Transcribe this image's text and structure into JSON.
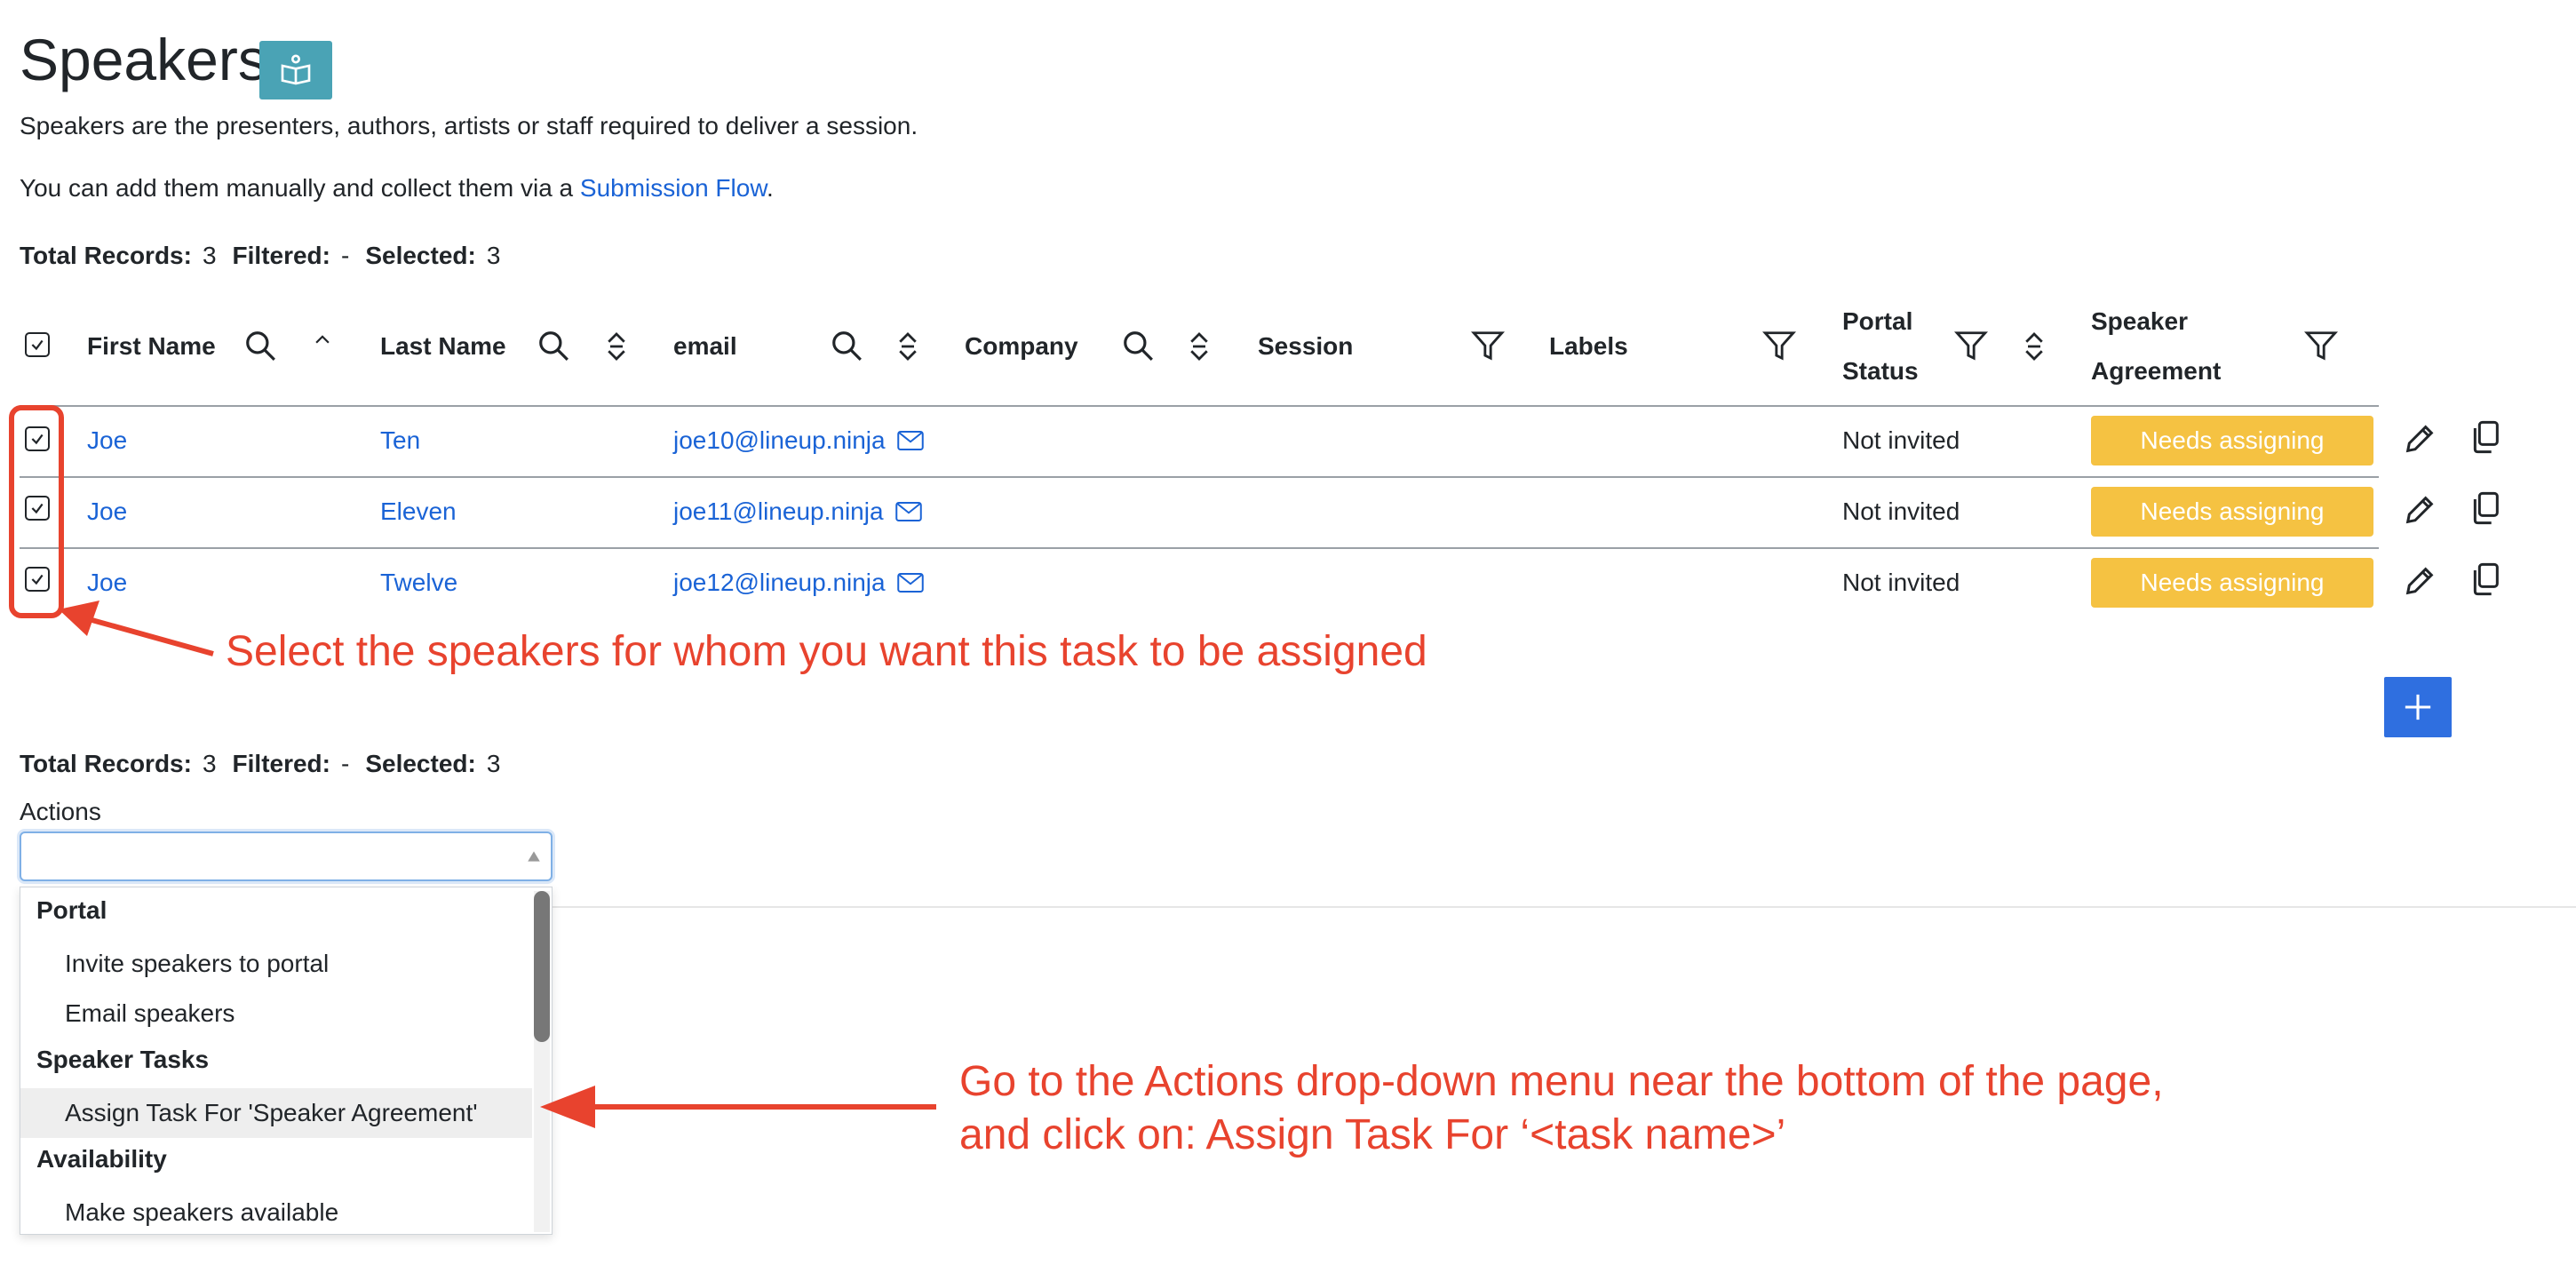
{
  "page": {
    "title": "Speakers",
    "description_1": "Speakers are the presenters, authors, artists or staff required to deliver a session.",
    "description_2_prefix": "You can add them manually and collect them via a ",
    "description_2_link": "Submission Flow",
    "description_2_suffix": "."
  },
  "summary": {
    "total_label": "Total Records:",
    "total_value": "3",
    "filtered_label": "Filtered:",
    "filtered_value": "-",
    "selected_label": "Selected:",
    "selected_value": "3"
  },
  "table": {
    "columns": {
      "first_name": "First Name",
      "last_name": "Last Name",
      "email": "email",
      "company": "Company",
      "session": "Session",
      "labels": "Labels",
      "portal_status_1": "Portal",
      "portal_status_2": "Status",
      "speaker_agreement_1": "Speaker",
      "speaker_agreement_2": "Agreement"
    },
    "rows": [
      {
        "first": "Joe",
        "last": "Ten",
        "email": "joe10@lineup.ninja",
        "portal": "Not invited",
        "agreement": "Needs assigning"
      },
      {
        "first": "Joe",
        "last": "Eleven",
        "email": "joe11@lineup.ninja",
        "portal": "Not invited",
        "agreement": "Needs assigning"
      },
      {
        "first": "Joe",
        "last": "Twelve",
        "email": "joe12@lineup.ninja",
        "portal": "Not invited",
        "agreement": "Needs assigning"
      }
    ]
  },
  "actions": {
    "label": "Actions",
    "value": "",
    "groups": [
      {
        "label": "Portal",
        "items": [
          "Invite speakers to portal",
          "Email speakers"
        ]
      },
      {
        "label": "Speaker Tasks",
        "items": [
          "Assign Task For 'Speaker Agreement'"
        ]
      },
      {
        "label": "Availability",
        "items": [
          "Make speakers available"
        ]
      }
    ]
  },
  "annotations": {
    "select_note": "Select the speakers for whom you want this task to be assigned",
    "menu_note_1": "Go to the Actions drop-down menu near the bottom of the page,",
    "menu_note_2": "and click on: Assign Task For ‘<task name>’"
  },
  "colors": {
    "link": "#1a63d6",
    "badge": "#f5c242",
    "help_button": "#4aa3b5",
    "add_button": "#2f6fe0",
    "annotation": "#e8432e"
  },
  "icons": {
    "help": "book-icon",
    "search": "search-icon",
    "sort": "sort-icon",
    "filter": "filter-icon",
    "mail": "mail-icon",
    "edit": "pencil-icon",
    "copy": "copy-icon",
    "add": "plus-icon"
  }
}
